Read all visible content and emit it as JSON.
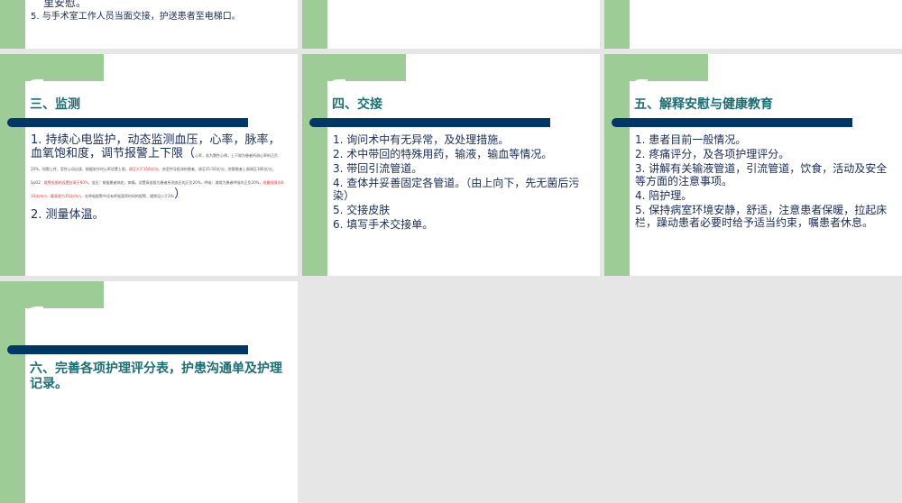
{
  "slides": [
    {
      "items": [
        "里安慰。",
        "5. 与手术室工作人员当面交接，护送患者至电梯口。"
      ]
    },
    {},
    {},
    {
      "title": "三、监测",
      "item1_main": "1. 持续心电监护，动态监测血压，心率，脉率，血氧饱和度，调节报警上下限（",
      "item1_note_a": "心率，若为窦性心律，上下限为患者所测心率的正负20%，如窦上性，室性心动过速，根据发作时心率设置上限，",
      "item1_note_red1": "调至大于150次/分，",
      "item1_note_b": "房室传导阻滞的患者，调至35-50次/分，房颤患者上限调至180次/分，SpO2：",
      "item1_note_red2": "报警低限的设置应高于90%，",
      "item1_note_c": "血压：根据患者病史，病情，设置高低限为患者所测血压的正负20%，呼吸：通常为患者呼吸的正负20%，",
      "item1_note_red3": "但最低限为8-10次/min，最高限为35次/min，",
      "item1_note_d": "在呼吸报警中还有呼吸暂停时间的报警，通常设小于20s",
      "item1_close": "）",
      "item2": "2. 测量体温。"
    },
    {
      "title": "四、交接",
      "items": [
        "1. 询问术中有无异常，及处理措施。",
        "2. 术中带回的特殊用药，输液，输血等情况。",
        "3. 带回引流管道。",
        "4. 查体并妥善固定各管道。（由上向下，先无菌后污染）",
        "5. 交接皮肤",
        "6. 填写手术交接单。"
      ]
    },
    {
      "title": "五、解释安慰与健康教育",
      "items": [
        "1. 患者目前一般情况。",
        "2. 疼痛评分，及各项护理评分。",
        "3. 讲解有关输液管道，引流管道，饮食，活动及安全等方面的注意事项。",
        "4. 陪护理。",
        "5. 保持病室环境安静，舒适，注意患者保暖，拉起床栏，躁动患者必要时给予适当约束，嘱患者休息。"
      ]
    },
    {
      "title": "六、完善各项护理评分表，护患沟通单及护理记录。"
    }
  ]
}
